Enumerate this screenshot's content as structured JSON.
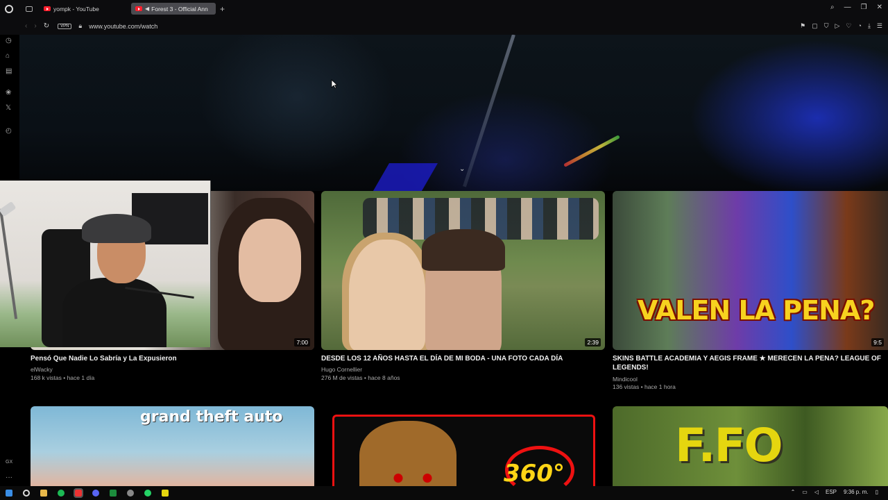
{
  "browser": {
    "tabs": [
      {
        "label": "yompk - YouTube",
        "active": false
      },
      {
        "label": "Forest 3 - Official Ann",
        "active": true
      }
    ],
    "new_tab": "+",
    "vpn": "VPN",
    "url": "www.youtube.com/watch"
  },
  "video_cards": [
    {
      "title": "Pensó Que Nadie Lo Sabría y La Expusieron",
      "channel": "elWacky",
      "stats": "168 k vistas • hace 1 día",
      "duration": "7:00"
    },
    {
      "title": "DESDE LOS 12 AÑOS HASTA EL DÍA DE MI BODA - UNA FOTO CADA DÍA",
      "channel": "Hugo Cornellier",
      "stats": "276 M de vistas • hace 8 años",
      "duration": "2:39"
    },
    {
      "title": "SKINS BATTLE ACADEMIA Y AEGIS FRAME ★ MERECEN LA PENA? LEAGUE OF LEGENDS!",
      "channel": "Mindicool",
      "stats": "136 vistas • hace 1 hora",
      "duration": "9:5",
      "thumb_text": "VALEN LA PENA?"
    }
  ],
  "lower_cards": [
    {
      "thumb_text": "grand theft auto"
    },
    {
      "thumb_text": "360°"
    },
    {
      "thumb_text": "F.FO"
    }
  ],
  "sidebar": {
    "gx_label": "GX",
    "more": "···"
  },
  "taskbar": {
    "lang": "ESP",
    "time": "9:36 p. m."
  },
  "colors": {
    "youtube_red": "#ff1f2d",
    "active_tab": "#4a4a4f",
    "accent_yellow": "#f7d21f"
  }
}
